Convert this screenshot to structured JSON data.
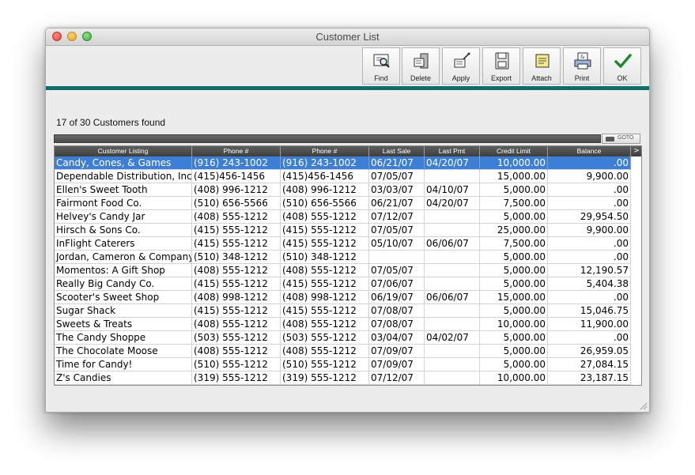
{
  "window": {
    "title": "Customer List"
  },
  "toolbar": {
    "buttons": [
      {
        "label": "Find",
        "icon": "find-icon"
      },
      {
        "label": "Delete",
        "icon": "delete-icon"
      },
      {
        "label": "Apply",
        "icon": "apply-icon"
      },
      {
        "label": "Export",
        "icon": "export-icon"
      },
      {
        "label": "Attach",
        "icon": "attach-icon"
      },
      {
        "label": "Print",
        "icon": "print-icon"
      },
      {
        "label": "OK",
        "icon": "checkmark-icon"
      }
    ]
  },
  "status": {
    "count_text": "17 of 30 Customers found"
  },
  "goto": {
    "label": "GOTO"
  },
  "table": {
    "columns": [
      "Customer Listing",
      "Phone #",
      "Phone #",
      "Last Sale",
      "Last Pmt",
      "Credit Limit",
      "Balance"
    ],
    "more_indicator": ">",
    "selected_row": 0,
    "rows": [
      [
        "Candy, Cones, & Games",
        "(916) 243-1002",
        "(916) 243-1002",
        "06/21/07",
        "04/20/07",
        "10,000.00",
        ".00"
      ],
      [
        "Dependable Distribution, Inc.",
        "(415)456-1456",
        "(415)456-1456",
        "07/05/07",
        "",
        "15,000.00",
        "9,900.00"
      ],
      [
        "Ellen's Sweet Tooth",
        "(408) 996-1212",
        "(408) 996-1212",
        "03/03/07",
        "04/10/07",
        "5,000.00",
        ".00"
      ],
      [
        "Fairmont Food Co.",
        "(510) 656-5566",
        "(510) 656-5566",
        "06/21/07",
        "04/20/07",
        "7,500.00",
        ".00"
      ],
      [
        "Helvey's Candy Jar",
        "(408) 555-1212",
        "(408) 555-1212",
        "07/12/07",
        "",
        "5,000.00",
        "29,954.50"
      ],
      [
        "Hirsch & Sons Co.",
        "(415) 555-1212",
        "(415) 555-1212",
        "07/05/07",
        "",
        "25,000.00",
        "9,900.00"
      ],
      [
        "InFlight Caterers",
        "(415) 555-1212",
        "(415) 555-1212",
        "05/10/07",
        "06/06/07",
        "7,500.00",
        ".00"
      ],
      [
        "Jordan, Cameron & Company",
        "(510) 348-1212",
        "(510) 348-1212",
        "",
        "",
        "5,000.00",
        ".00"
      ],
      [
        "Momentos: A Gift Shop",
        "(408) 555-1212",
        "(408) 555-1212",
        "07/05/07",
        "",
        "5,000.00",
        "12,190.57"
      ],
      [
        "Really Big Candy Co.",
        "(415) 555-1212",
        "(415) 555-1212",
        "07/06/07",
        "",
        "5,000.00",
        "5,404.38"
      ],
      [
        "Scooter's Sweet Shop",
        "(408) 998-1212",
        "(408) 998-1212",
        "06/19/07",
        "06/06/07",
        "15,000.00",
        ".00"
      ],
      [
        "Sugar Shack",
        "(415) 555-1212",
        "(415) 555-1212",
        "07/08/07",
        "",
        "5,000.00",
        "15,046.75"
      ],
      [
        "Sweets & Treats",
        "(408) 555-1212",
        "(408) 555-1212",
        "07/08/07",
        "",
        "10,000.00",
        "11,900.00"
      ],
      [
        "The Candy Shoppe",
        "(503) 555-1212",
        "(503) 555-1212",
        "03/04/07",
        "04/02/07",
        "5,000.00",
        ".00"
      ],
      [
        "The Chocolate Moose",
        "(408) 555-1212",
        "(408) 555-1212",
        "07/09/07",
        "",
        "5,000.00",
        "26,959.05"
      ],
      [
        "Time for Candy!",
        "(510) 555-1212",
        "(510) 555-1212",
        "07/09/07",
        "",
        "5,000.00",
        "27,084.15"
      ],
      [
        "Z's Candies",
        "(319) 555-1212",
        "(319) 555-1212",
        "07/12/07",
        "",
        "10,000.00",
        "23,187.15"
      ]
    ]
  }
}
